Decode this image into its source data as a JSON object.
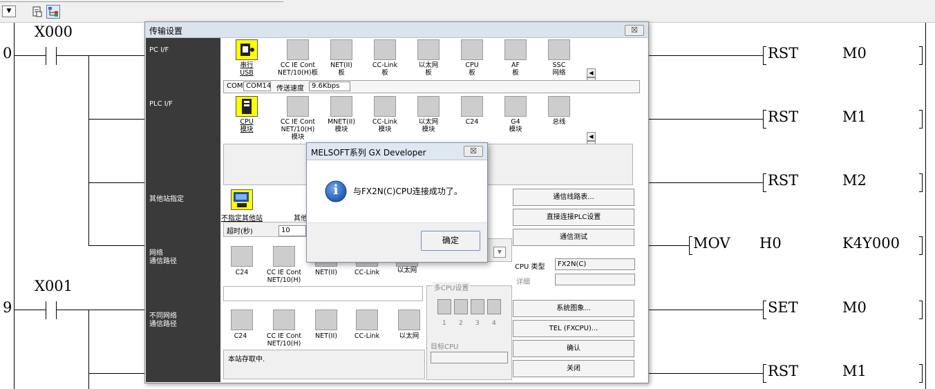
{
  "toolbar": {
    "dropdown_glyph": "▼",
    "buttons": [
      {
        "icon": "document-sheet-icon"
      },
      {
        "icon": "tree-structure-icon",
        "pressed": true
      }
    ]
  },
  "ladder": {
    "steps": [
      {
        "number": "0",
        "contact": "X000"
      },
      {
        "number": "9",
        "contact": "X001"
      }
    ],
    "instructions": [
      {
        "op": "RST",
        "operands": [
          "M0"
        ]
      },
      {
        "op": "RST",
        "operands": [
          "M1"
        ]
      },
      {
        "op": "RST",
        "operands": [
          "M2"
        ]
      },
      {
        "op": "MOV",
        "operands": [
          "H0",
          "K4Y000"
        ]
      },
      {
        "op": "SET",
        "operands": [
          "M0"
        ]
      },
      {
        "op": "RST",
        "operands": [
          "M1"
        ]
      }
    ]
  },
  "transfer_dialog": {
    "title": "传输设置",
    "close_glyph": "☒",
    "side_labels": {
      "pc_if": "PC I/F",
      "plc_if": "PLC I/F",
      "other_station": "其他站指定",
      "network_route": "网络\n通信路径",
      "diff_network_route": "不同网络\n通信路径"
    },
    "pc_if_items": [
      {
        "caption": "串行\nUSB",
        "selected": true
      },
      {
        "caption": "CC IE Cont\nNET/10(H)板"
      },
      {
        "caption": "NET(II)\n板"
      },
      {
        "caption": "CC-Link\n板"
      },
      {
        "caption": "以太网\n板"
      },
      {
        "caption": "CPU\n板"
      },
      {
        "caption": "AF\n板"
      },
      {
        "caption": "SSC\n网络"
      }
    ],
    "com_row": {
      "com_label": "COM",
      "com_value": "COM14",
      "speed_label": "传送速度",
      "speed_value": "9.6Kbps"
    },
    "plc_if_items": [
      {
        "caption": "CPU\n模块",
        "selected": true
      },
      {
        "caption": "CC IE Cont\nNET/10(H)\n模块"
      },
      {
        "caption": "MNET(II)\n模块"
      },
      {
        "caption": "CC-Link\n模块"
      },
      {
        "caption": "以太网\n模块"
      },
      {
        "caption": "C24"
      },
      {
        "caption": "G4\n模块"
      },
      {
        "caption": "总线"
      }
    ],
    "other_station": {
      "item_caption": "不指定其他站",
      "item2_caption": "其他",
      "timeout_label": "超时(秒)",
      "timeout_value": "10"
    },
    "network_items": [
      {
        "caption": "C24"
      },
      {
        "caption": "CC IE Cont\nNET/10(H)"
      },
      {
        "caption": "NET(II)"
      },
      {
        "caption": "CC-Link"
      },
      {
        "caption": "以太网"
      }
    ],
    "diff_network_items": [
      {
        "caption": "C24"
      },
      {
        "caption": "CC IE Cont\nNET/10(H)"
      },
      {
        "caption": "NET(II)"
      },
      {
        "caption": "CC-Link"
      },
      {
        "caption": "以太网"
      }
    ],
    "multi_cpu": {
      "label": "多CPU设置",
      "numbers": [
        "1",
        "2",
        "3",
        "4"
      ],
      "target_label": "目标CPU"
    },
    "status_text": "本站存取中.",
    "buttons": {
      "route_list": "通信线路表...",
      "direct_connect": "直接连接PLC设置",
      "comm_test": "通信测试",
      "system_image": "系统图象...",
      "tel": "TEL (FXCPU)...",
      "ok": "确认",
      "close": "关闭"
    },
    "cpu_type_label": "CPU 类型",
    "cpu_type_value": "FX2N(C)",
    "detail_label": "详细"
  },
  "message_box": {
    "title": "MELSOFT系列 GX Developer",
    "close_glyph": "☒",
    "icon": "info-icon",
    "icon_glyph": "i",
    "message": "与FX2N(C)CPU连接成功了。",
    "ok_label": "确定"
  },
  "colors": {
    "dialog_bg": "#f0f0f0",
    "sidebar": "#3a3a3a",
    "selected_icon": "#ffff00",
    "info_blue": "#1f5fb8"
  }
}
